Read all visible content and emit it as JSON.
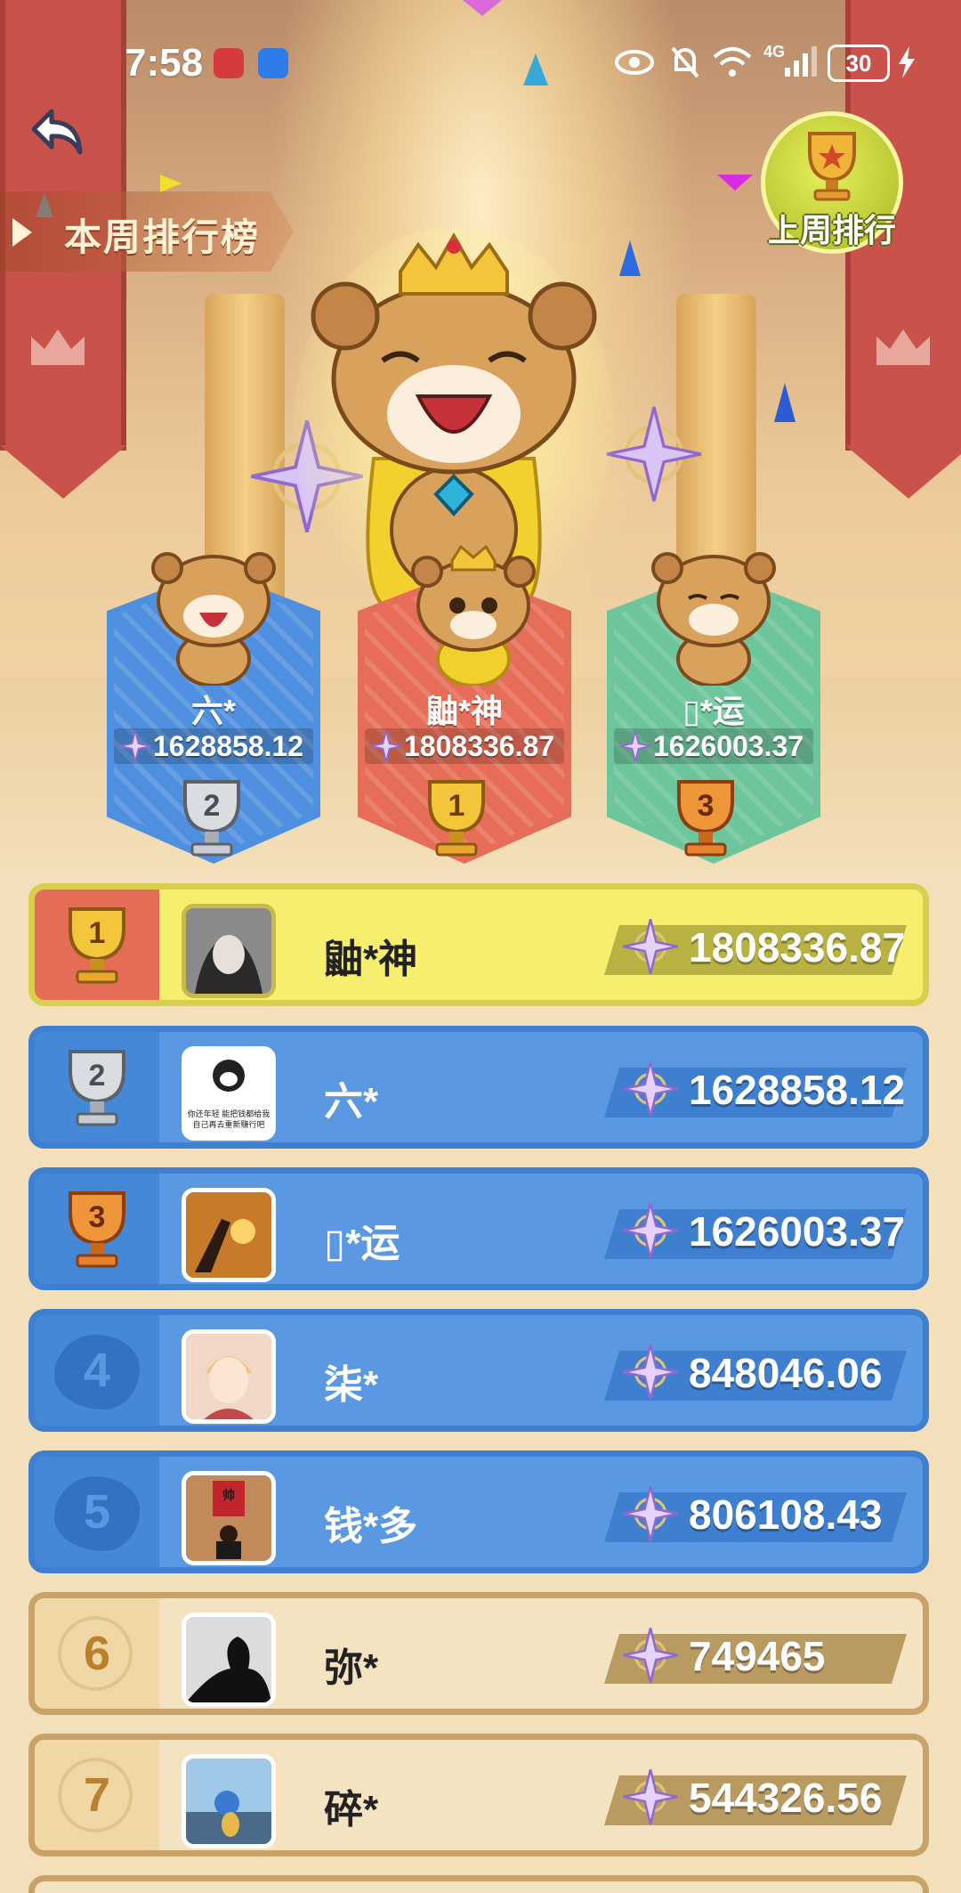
{
  "status_bar": {
    "time": "7:58",
    "network": "4G",
    "battery": "30",
    "icons": [
      "huawei-app-icon",
      "message-app-icon",
      "eye-icon",
      "mute-icon",
      "wifi-icon",
      "signal-icon",
      "battery-icon",
      "charging-icon"
    ]
  },
  "header": {
    "back_icon": "back-arrow-icon",
    "current_tab": "本周排行榜",
    "last_week_button": "上周排行"
  },
  "podium": [
    {
      "rank": "2",
      "name": "六*",
      "score": "1628858.12",
      "color": "#4f8fdf"
    },
    {
      "rank": "1",
      "name": "鼬*神",
      "score": "1808336.87",
      "color": "#e66d57"
    },
    {
      "rank": "3",
      "name": "▯*运",
      "score": "1626003.37",
      "color": "#6dc59b"
    }
  ],
  "ranking": [
    {
      "rank": "1",
      "name": "鼬*神",
      "score": "1808336.87",
      "style": "gold"
    },
    {
      "rank": "2",
      "name": "六*",
      "score": "1628858.12",
      "style": "blue"
    },
    {
      "rank": "3",
      "name": "▯*运",
      "score": "1626003.37",
      "style": "blue"
    },
    {
      "rank": "4",
      "name": "柒*",
      "score": "848046.06",
      "style": "blue"
    },
    {
      "rank": "5",
      "name": "钱*多",
      "score": "806108.43",
      "style": "blue"
    },
    {
      "rank": "6",
      "name": "弥*",
      "score": "749465",
      "style": "plain"
    },
    {
      "rank": "7",
      "name": "碎*",
      "score": "544326.56",
      "style": "plain"
    }
  ],
  "avatar_texts": {
    "row2_line1": "你还年轻 能把钱都给我",
    "row2_line2": "自己再去重新赚行吧",
    "row5_sign": "帅"
  },
  "colors": {
    "gold_row": "#f6ee6f",
    "blue_row": "#5a99e2",
    "plain_row": "#f4e3c1",
    "accent_red": "#e56d55"
  }
}
